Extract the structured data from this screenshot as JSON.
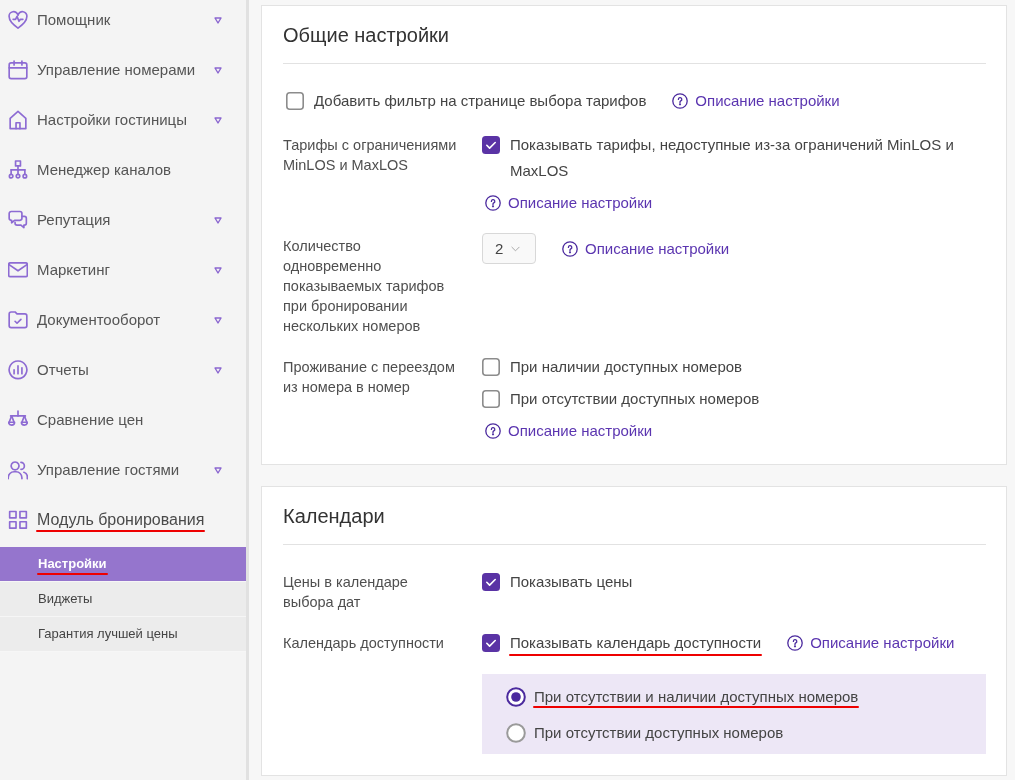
{
  "sidebar": {
    "items": [
      {
        "label": "Помощник",
        "dropdown": true,
        "underlined": false
      },
      {
        "label": "Управление номерами",
        "dropdown": true,
        "underlined": false
      },
      {
        "label": "Настройки гостиницы",
        "dropdown": true,
        "underlined": false
      },
      {
        "label": "Менеджер каналов",
        "dropdown": false,
        "underlined": false
      },
      {
        "label": "Репутация",
        "dropdown": true,
        "underlined": false
      },
      {
        "label": "Маркетинг",
        "dropdown": true,
        "underlined": false
      },
      {
        "label": "Документооборот",
        "dropdown": true,
        "underlined": false
      },
      {
        "label": "Отчеты",
        "dropdown": true,
        "underlined": false
      },
      {
        "label": "Сравнение цен",
        "dropdown": false,
        "underlined": false
      },
      {
        "label": "Управление гостями",
        "dropdown": true,
        "underlined": false
      },
      {
        "label": "Модуль бронирования",
        "dropdown": false,
        "underlined": true,
        "children": [
          {
            "label": "Настройки",
            "selected": true,
            "underlined": true
          },
          {
            "label": "Виджеты",
            "selected": false,
            "underlined": false
          },
          {
            "label": "Гарантия лучшей цены",
            "selected": false,
            "underlined": false
          }
        ]
      }
    ]
  },
  "sections": [
    {
      "title": "Общие настройки",
      "rows": [
        {
          "kind": "standalone",
          "controls": [
            {
              "kind": "checkbox",
              "checked": false,
              "label": "Добавить фильтр на странице выбора тарифов",
              "underlined": false,
              "help": "Описание настройки"
            }
          ]
        },
        {
          "kind": "setting",
          "label": "Тарифы с ограничениями MinLOS и MaxLOS",
          "controls": [
            {
              "kind": "checkbox",
              "checked": true,
              "label": "Показывать тарифы, недоступные из-за ограничений MinLOS и MaxLOS",
              "underlined": false
            },
            {
              "kind": "help",
              "label": "Описание настройки"
            }
          ]
        },
        {
          "kind": "setting",
          "label": "Количество одновременно показываемых тарифов при бронировании нескольких номеров",
          "controls": [
            {
              "kind": "select",
              "value": "2",
              "help": "Описание настройки"
            }
          ]
        },
        {
          "kind": "setting",
          "label": "Проживание с переездом из номера в номер",
          "controls": [
            {
              "kind": "checkbox",
              "checked": false,
              "label": "При наличии доступных номеров",
              "underlined": false
            },
            {
              "kind": "checkbox",
              "checked": false,
              "label": "При отсутствии доступных номеров",
              "underlined": false
            },
            {
              "kind": "help",
              "label": "Описание настройки"
            }
          ]
        }
      ]
    },
    {
      "title": "Календари",
      "rows": [
        {
          "kind": "setting",
          "label": "Цены в календаре выбора дат",
          "controls": [
            {
              "kind": "checkbox",
              "checked": true,
              "label": "Показывать цены",
              "underlined": false
            }
          ]
        },
        {
          "kind": "setting",
          "label": "Календарь доступности",
          "controls": [
            {
              "kind": "checkbox",
              "checked": true,
              "label": "Показывать календарь доступности",
              "underlined": true,
              "help": "Описание настройки"
            },
            {
              "kind": "radio_group",
              "options": [
                {
                  "label": "При отсутствии и наличии доступных номеров",
                  "selected": true,
                  "underlined": true
                },
                {
                  "label": "При отсутствии доступных номеров",
                  "selected": false,
                  "underlined": false
                }
              ]
            }
          ]
        }
      ]
    }
  ]
}
